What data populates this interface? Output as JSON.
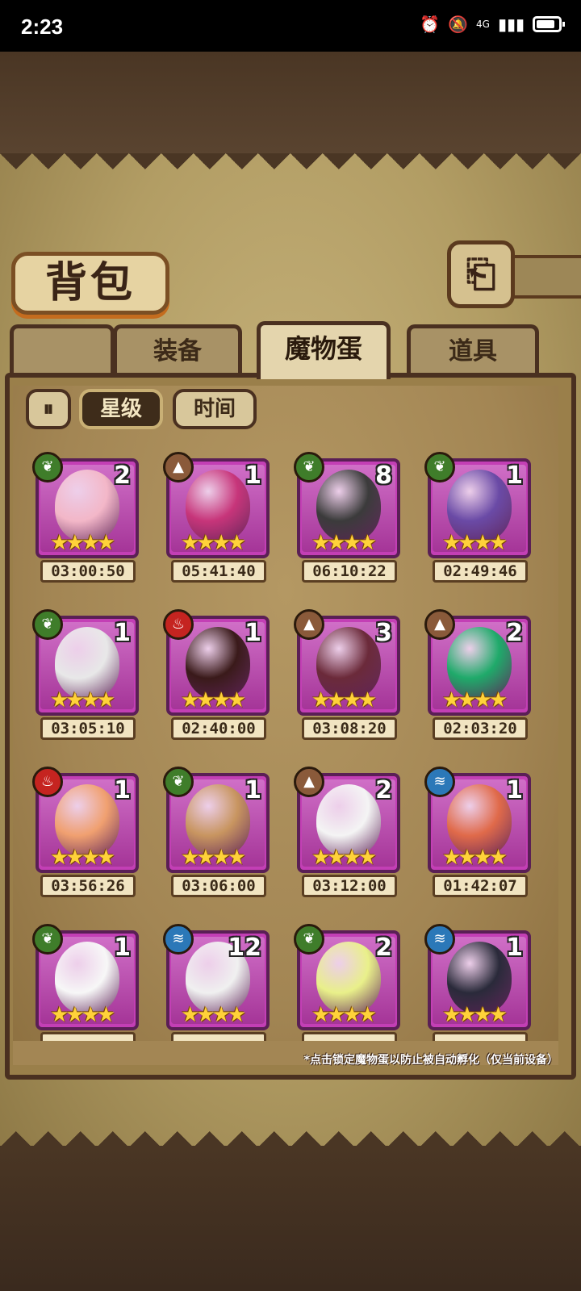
{
  "status_bar": {
    "time": "2:23",
    "network": "4G",
    "icons": [
      "alarm-icon",
      "mute-icon",
      "signal-icon",
      "battery-icon"
    ]
  },
  "header": {
    "title": "背包",
    "back_icon": "back-arrow-icon"
  },
  "tabs": [
    {
      "label": "装备",
      "active": false
    },
    {
      "label": "魔物蛋",
      "active": true
    },
    {
      "label": "道具",
      "active": false
    }
  ],
  "filters": {
    "pause_icon": "play-pause-icon",
    "sort_star": "星级",
    "sort_time": "时间",
    "selected": "星级"
  },
  "stars_glyph": "★★★★",
  "eggs": [
    {
      "element": "grass",
      "qty": "2",
      "timer": "03:00:50",
      "color": "#f3b7c8"
    },
    {
      "element": "earth",
      "qty": "1",
      "timer": "05:41:40",
      "color": "#c7357a"
    },
    {
      "element": "grass",
      "qty": "8",
      "timer": "06:10:22",
      "color": "#3b3b3b"
    },
    {
      "element": "grass",
      "qty": "1",
      "timer": "02:49:46",
      "color": "#6a4aa6"
    },
    {
      "element": "grass",
      "qty": "1",
      "timer": "03:05:10",
      "color": "#e8e8e8"
    },
    {
      "element": "fire",
      "qty": "1",
      "timer": "02:40:00",
      "color": "#3a1a1a"
    },
    {
      "element": "earth",
      "qty": "3",
      "timer": "03:08:20",
      "color": "#6b2a3a"
    },
    {
      "element": "earth",
      "qty": "2",
      "timer": "02:03:20",
      "color": "#1faa6a"
    },
    {
      "element": "fire",
      "qty": "1",
      "timer": "03:56:26",
      "color": "#f0a070"
    },
    {
      "element": "grass",
      "qty": "1",
      "timer": "03:06:00",
      "color": "#c89560"
    },
    {
      "element": "earth",
      "qty": "2",
      "timer": "03:12:00",
      "color": "#f4f4f4"
    },
    {
      "element": "water",
      "qty": "1",
      "timer": "01:42:07",
      "color": "#e06a4a"
    },
    {
      "element": "grass",
      "qty": "1",
      "timer": "",
      "color": "#f7f7f7"
    },
    {
      "element": "water",
      "qty": "12",
      "timer": "",
      "color": "#f0f0f0"
    },
    {
      "element": "grass",
      "qty": "2",
      "timer": "",
      "color": "#e9f08a"
    },
    {
      "element": "water",
      "qty": "1",
      "timer": "",
      "color": "#2a2a3a"
    }
  ],
  "element_icons": {
    "grass": "leaf-icon",
    "earth": "mountain-icon",
    "fire": "flame-icon",
    "water": "wave-icon"
  },
  "element_glyphs": {
    "grass": "❦",
    "earth": "▲",
    "fire": "♨",
    "water": "≋"
  },
  "footer_note": "*点击锁定魔物蛋以防止被自动孵化（仅当前设备）"
}
